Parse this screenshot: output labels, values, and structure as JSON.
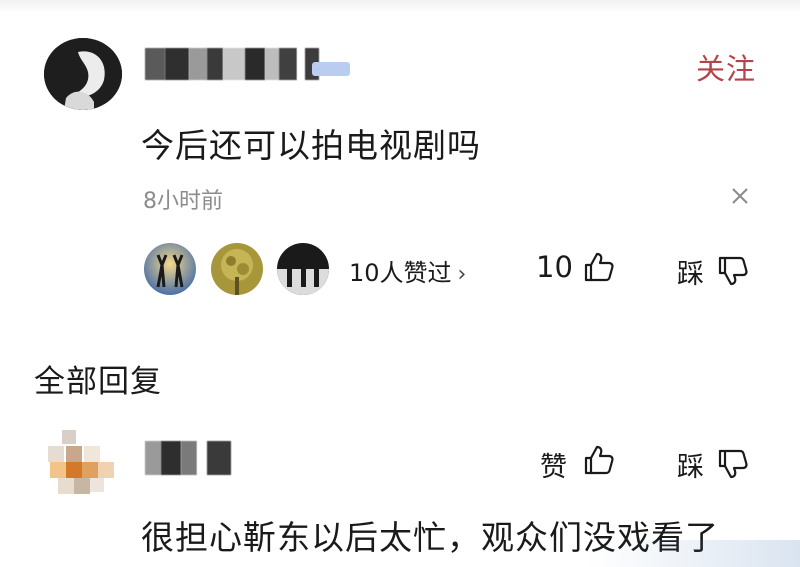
{
  "comment": {
    "username": "",
    "follow_label": "关注",
    "text": "今后还可以拍电视剧吗",
    "time": "8小时前",
    "likers_label": "10人赞过",
    "likers_chevron": "›",
    "like_count": "10",
    "dislike_label": "踩"
  },
  "replies": {
    "section_title": "全部回复",
    "items": [
      {
        "username": "",
        "like_label": "赞",
        "dislike_label": "踩",
        "text": "很担心靳东以后太忙，观众们没戏看了"
      }
    ]
  },
  "icons": {
    "close": "close-icon",
    "like": "thumbs-up-icon",
    "dislike": "thumbs-down-icon"
  },
  "colors": {
    "follow": "#b4434a",
    "muted_text": "#8c8c8c",
    "text": "#1a1a1a"
  }
}
